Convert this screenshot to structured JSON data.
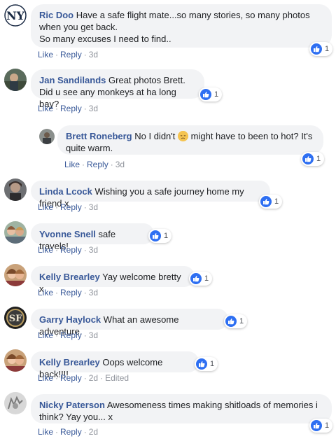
{
  "comments": [
    {
      "author": "Ric Doo",
      "text": "Have a safe flight mate...so many stories, so many photos when you get back.",
      "text2": "So many excuses I need to find..",
      "like": "Like",
      "reply": "Reply",
      "time": "3d",
      "reactions": "1"
    },
    {
      "author": "Jan Sandilands",
      "text": "Great photos Brett.",
      "text2": "Did u see any monkeys at ha long bay?",
      "like": "Like",
      "reply": "Reply",
      "time": "3d",
      "reactions": "1"
    },
    {
      "author": "Brett Roneberg",
      "text_before": "No I didn't",
      "text_after": "might have to been to hot? It's quite warm.",
      "emoji": "disappointed-face-emoji",
      "like": "Like",
      "reply": "Reply",
      "time": "3d",
      "reactions": "1"
    },
    {
      "author": "Linda Lcock",
      "text": "Wishing you a safe journey home my friend x",
      "like": "Like",
      "reply": "Reply",
      "time": "3d",
      "reactions": "1"
    },
    {
      "author": "Yvonne Snell",
      "text": "safe travels!",
      "like": "Like",
      "reply": "Reply",
      "time": "3d",
      "reactions": "1"
    },
    {
      "author": "Kelly Brearley",
      "text": "Yay welcome bretty x",
      "like": "Like",
      "reply": "Reply",
      "time": "3d",
      "reactions": "1"
    },
    {
      "author": "Garry Haylock",
      "text": "What an awesome adventure.",
      "like": "Like",
      "reply": "Reply",
      "time": "3d",
      "reactions": "1"
    },
    {
      "author": "Kelly Brearley",
      "text": "Oops welcome back!!!!",
      "like": "Like",
      "reply": "Reply",
      "time": "2d",
      "edited": "Edited",
      "reactions": "1"
    },
    {
      "author": "Nicky Paterson",
      "text": "Awesomeness times making shitloads of memories i think? Yay you... x",
      "like": "Like",
      "reply": "Reply",
      "time": "2d",
      "reactions": "1"
    }
  ],
  "colors": {
    "author": "#385898",
    "bubble": "#f2f3f5",
    "like_blue": "#2e6ff2",
    "meta_grey": "#90949c"
  },
  "icons": {
    "reaction": "like-thumb-icon"
  }
}
